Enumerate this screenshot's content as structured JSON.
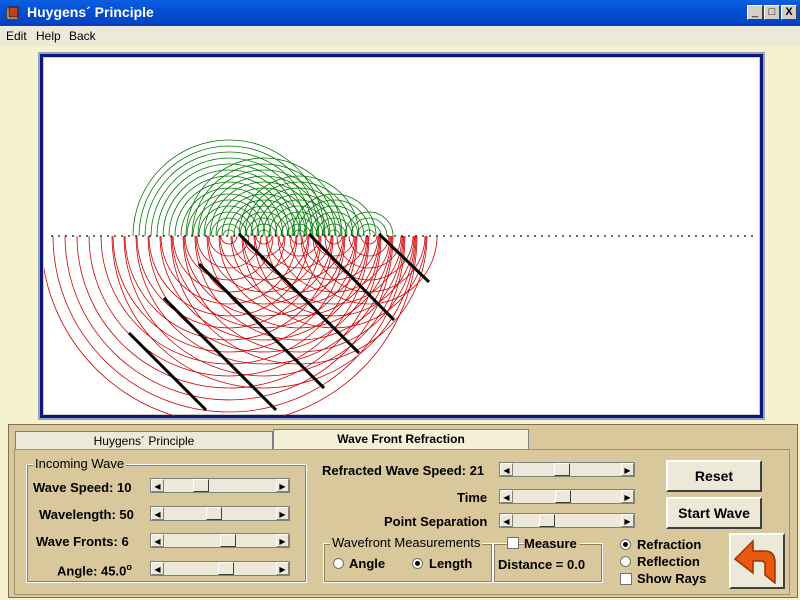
{
  "window": {
    "title": "Huygens´ Principle",
    "min": "_",
    "max": "□",
    "close": "X"
  },
  "menu": [
    {
      "label": "Edit"
    },
    {
      "label": "Help"
    },
    {
      "label": "Back"
    }
  ],
  "tabs": [
    {
      "label": "Huygens´ Principle"
    },
    {
      "label": "Wave Front Refraction"
    }
  ],
  "incoming_wave": {
    "title": "Incoming Wave",
    "wave_speed_label": "Wave Speed: 10",
    "wavelength_label": "Wavelength: 50",
    "wave_fronts_label": "Wave Fronts: 6",
    "angle_label": "Angle: 45.0",
    "angle_unit": "o",
    "wave_speed_level": 0.3,
    "wavelength_level": 0.44,
    "wave_fronts_level": 0.58,
    "angle_level": 0.56
  },
  "refraction_controls": {
    "refracted_speed_label": "Refracted Wave Speed: 21",
    "time_label": "Time",
    "point_sep_label": "Point Separation",
    "refracted_speed_level": 0.45,
    "time_level": 0.46,
    "point_sep_level": 0.28
  },
  "measurements": {
    "title": "Wavefront Measurements",
    "angle_option": "Angle",
    "length_option": "Length",
    "measure_label": "Measure",
    "distance_label": "Distance = 0.0"
  },
  "buttons": {
    "reset": "Reset",
    "start": "Start Wave"
  },
  "mode": {
    "refraction": "Refraction",
    "reflection": "Reflection",
    "show_rays": "Show Rays"
  },
  "colors": {
    "incident": "#cc0000",
    "refracted": "#007700",
    "wavefront": "#000000",
    "back_arrow": "#e85a10"
  }
}
